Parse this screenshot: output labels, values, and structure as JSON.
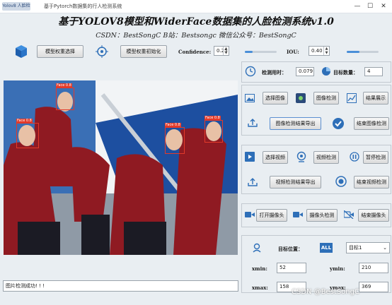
{
  "window": {
    "app_badge": "Yolov8 人脸检测",
    "title": "基于Pytorch数据集的行人检测系统",
    "minimize": "—",
    "maximize": "☐",
    "close": "✕"
  },
  "header": {
    "title": "基于YOLOV8模型和WiderFace数据集的人脸检测系统v1.0",
    "subtitle": "CSDN：BestSongC  B站：Bestsongc  微信公众号：BestSongC"
  },
  "toolbar": {
    "model_select_label": "模型权重选择",
    "model_init_label": "模型权重初始化",
    "confidence_label": "Confidence:",
    "confidence_value": "0.25",
    "confidence_level": 0.25,
    "iou_label": "IOU:",
    "iou_value": "0.40",
    "iou_level": 0.4
  },
  "image_view": {
    "face_label": "Face 0.8"
  },
  "stats": {
    "time_label": "检测用时：",
    "time_value": "0.079",
    "count_label": "目标数量：",
    "count_value": "4"
  },
  "image_section": {
    "select_label": "选择图像",
    "detect_label": "图像检测",
    "show_label": "结果展示",
    "export_label": "图像检测结果导出",
    "end_label": "结束图像检测"
  },
  "video_section": {
    "select_label": "选择视频",
    "detect_label": "视频检测",
    "pause_label": "暂停检测",
    "export_label": "视频检测结果导出",
    "end_label": "结束视频检测"
  },
  "camera_section": {
    "open_label": "打开摄像头",
    "detect_label": "摄像头检测",
    "close_label": "结束摄像头"
  },
  "target": {
    "position_label": "目标位置：",
    "all_badge": "ALL",
    "selected": "目标1",
    "xmin_label": "xmin:",
    "xmin_value": "52",
    "ymin_label": "ymin:",
    "ymin_value": "210",
    "xmax_label": "xmax:",
    "xmax_value": "158",
    "ymax_label": "ymax:",
    "ymax_value": "369"
  },
  "status": {
    "message": "图片检测成功! ! !"
  },
  "watermark": "CSDN @BestSongC",
  "colors": {
    "accent": "#2e6fb8",
    "face_box": "#e23a2a"
  }
}
